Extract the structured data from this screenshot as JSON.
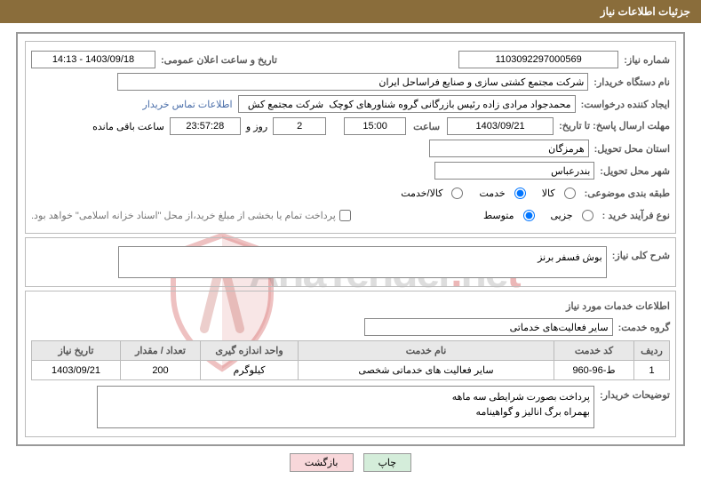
{
  "header": {
    "title": "جزئیات اطلاعات نیاز"
  },
  "form": {
    "need_no_label": "شماره نیاز:",
    "need_no": "1103092297000569",
    "announce_label": "تاریخ و ساعت اعلان عمومی:",
    "announce_date": "1403/09/18 - 14:13",
    "buyer_label": "نام دستگاه خریدار:",
    "buyer": "شرکت مجتمع کشتی سازی و صنایع فراساحل ایران",
    "creator_label": "ایجاد کننده درخواست:",
    "creator": "محمدجواد مرادی زاده رئیس بازرگانی گروه شناورهای کوچک  شرکت مجتمع کش",
    "contact_link": "اطلاعات تماس خریدار",
    "deadline_label": "مهلت ارسال پاسخ: تا تاریخ:",
    "deadline_date": "1403/09/21",
    "time_label": "ساعت",
    "deadline_time": "15:00",
    "days": "2",
    "days_and": "روز و",
    "countdown": "23:57:28",
    "remaining": "ساعت باقی مانده",
    "province_label": "استان محل تحویل:",
    "province": "هرمزگان",
    "city_label": "شهر محل تحویل:",
    "city": "بندرعباس",
    "category_label": "طبقه بندی موضوعی:",
    "cat_kala": "کالا",
    "cat_khadamat": "خدمت",
    "cat_both": "کالا/خدمت",
    "process_label": "نوع فرآیند خرید :",
    "proc_partial": "جزیی",
    "proc_medium": "متوسط",
    "treasury_note": "پرداخت تمام یا بخشی از مبلغ خرید،از محل \"اسناد خزانه اسلامی\" خواهد بود.",
    "summary_label": "شرح کلی نیاز:",
    "summary_text": "بوش فسفر برنز",
    "services_heading": "اطلاعات خدمات مورد نیاز",
    "group_label": "گروه خدمت:",
    "group_value": "سایر فعالیت‌های خدماتی",
    "table": {
      "headers": {
        "row": "ردیف",
        "code": "کد خدمت",
        "name": "نام خدمت",
        "unit": "واحد اندازه گیری",
        "qty": "تعداد / مقدار",
        "date": "تاریخ نیاز"
      },
      "rows": [
        {
          "row": "1",
          "code": "ط-96-960",
          "name": "سایر فعالیت های خدماتی شخصی",
          "unit": "کیلوگرم",
          "qty": "200",
          "date": "1403/09/21"
        }
      ]
    },
    "buyer_note_label": "توضیحات خریدار:",
    "buyer_note_line1": "پرداخت بصورت شرایطی سه ماهه",
    "buyer_note_line2": "بهمراه برگ انالیز و گواهینامه"
  },
  "buttons": {
    "print": "چاپ",
    "back": "بازگشت"
  },
  "watermark": "AriaTender.net"
}
